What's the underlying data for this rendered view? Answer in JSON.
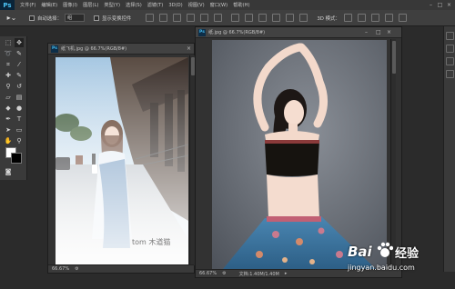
{
  "app": {
    "logo": "Ps"
  },
  "menu": [
    "文件(F)",
    "编辑(E)",
    "图像(I)",
    "图层(L)",
    "类型(Y)",
    "选择(S)",
    "滤镜(T)",
    "3D(D)",
    "视图(V)",
    "窗口(W)",
    "帮助(H)"
  ],
  "options": {
    "auto_select_label": "自动选择：",
    "auto_select_value": "组",
    "show_transform_label": "显示变换控件",
    "mode_3d_label": "3D 模式："
  },
  "doc_left": {
    "title": "纸飞机.jpg @ 66.7%(RGB/8#)",
    "zoom": "66.67%",
    "watermark_text": "tom 木道猫"
  },
  "doc_right": {
    "title": "纸.jpg @ 66.7%(RGB/8#)",
    "zoom": "66.67%",
    "doc_info": "文档:1.40M/1.40M"
  },
  "watermark": {
    "brand": "Bai",
    "brand2": "经验",
    "url": "jingyan.baidu.com"
  },
  "colors": {
    "foreground": "#ffffff",
    "background": "#000000",
    "accent": "#4cc4f5"
  }
}
